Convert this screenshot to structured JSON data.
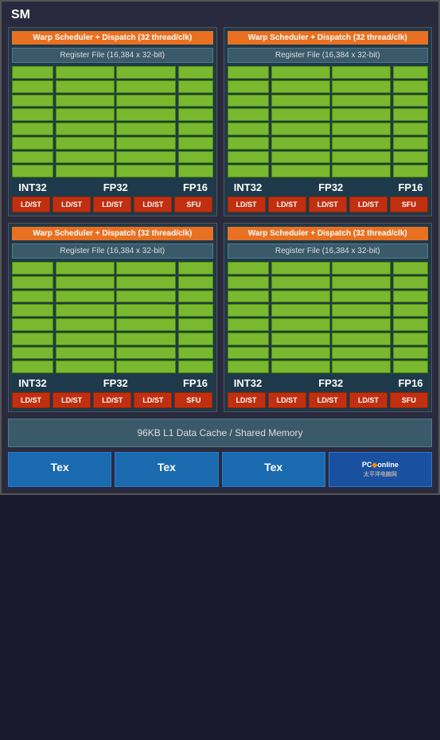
{
  "title": "SM",
  "quadrants": [
    {
      "id": 1,
      "warp_label": "Warp Scheduler + Dispatch (32 thread/clk)",
      "register_label": "Register File (16,384 x 32-bit)",
      "int32_label": "INT32",
      "fp32_label": "FP32",
      "fp16_label": "FP16",
      "bottom_units": [
        "LD/ST",
        "LD/ST",
        "LD/ST",
        "LD/ST",
        "SFU"
      ]
    },
    {
      "id": 2,
      "warp_label": "Warp Scheduler + Dispatch (32 thread/clk)",
      "register_label": "Register File (16,384 x 32-bit)",
      "int32_label": "INT32",
      "fp32_label": "FP32",
      "fp16_label": "FP16",
      "bottom_units": [
        "LD/ST",
        "LD/ST",
        "LD/ST",
        "LD/ST",
        "SFU"
      ]
    },
    {
      "id": 3,
      "warp_label": "Warp Scheduler + Dispatch (32 thread/clk)",
      "register_label": "Register File (16,384 x 32-bit)",
      "int32_label": "INT32",
      "fp32_label": "FP32",
      "fp16_label": "FP16",
      "bottom_units": [
        "LD/ST",
        "LD/ST",
        "LD/ST",
        "LD/ST",
        "SFU"
      ]
    },
    {
      "id": 4,
      "warp_label": "Warp Scheduler + Dispatch (32 thread/clk)",
      "register_label": "Register File (16,384 x 32-bit)",
      "int32_label": "INT32",
      "fp32_label": "FP32",
      "fp16_label": "FP16",
      "bottom_units": [
        "LD/ST",
        "LD/ST",
        "LD/ST",
        "LD/ST",
        "SFU"
      ]
    }
  ],
  "l1_cache_label": "96KB L1 Data Cache / Shared Memory",
  "tex_buttons": [
    "Tex",
    "Tex",
    "Tex"
  ],
  "logo_text": "PConline",
  "accent_orange": "#e87020",
  "accent_green": "#7ab830",
  "accent_blue": "#1a6ab0",
  "accent_red": "#c03010"
}
